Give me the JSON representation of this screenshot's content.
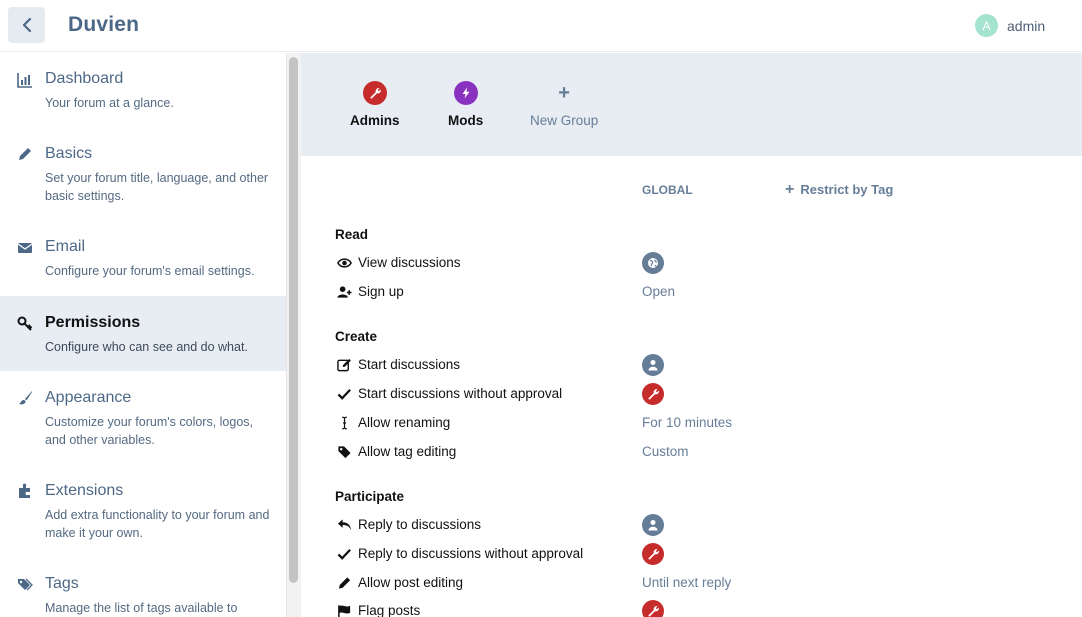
{
  "header": {
    "brand": "Duvien",
    "user": {
      "initial": "A",
      "name": "admin",
      "avatar_color": "#a4e3cf"
    },
    "back_icon": "chevron-left-icon"
  },
  "sidebar": {
    "items": [
      {
        "title": "Dashboard",
        "desc": "Your forum at a glance.",
        "icon": "bar-chart-icon",
        "active": false
      },
      {
        "title": "Basics",
        "desc": "Set your forum title, language, and other basic settings.",
        "icon": "pencil-icon",
        "active": false
      },
      {
        "title": "Email",
        "desc": "Configure your forum's email settings.",
        "icon": "envelope-icon",
        "active": false
      },
      {
        "title": "Permissions",
        "desc": "Configure who can see and do what.",
        "icon": "key-icon",
        "active": true
      },
      {
        "title": "Appearance",
        "desc": "Customize your forum's colors, logos, and other variables.",
        "icon": "paint-brush-icon",
        "active": false
      },
      {
        "title": "Extensions",
        "desc": "Add extra functionality to your forum and make it your own.",
        "icon": "puzzle-icon",
        "active": false
      },
      {
        "title": "Tags",
        "desc": "Manage the list of tags available to",
        "icon": "tags-icon",
        "active": false
      }
    ]
  },
  "groups": [
    {
      "label": "Admins",
      "icon": "wrench-icon",
      "color": "#c62c2c"
    },
    {
      "label": "Mods",
      "icon": "bolt-icon",
      "color": "#8a32c0"
    },
    {
      "label": "New Group",
      "icon": "plus-icon"
    }
  ],
  "columns": {
    "global": "GLOBAL",
    "restrict": "Restrict by Tag"
  },
  "sections": {
    "read": "Read",
    "create": "Create",
    "participate": "Participate"
  },
  "permissions": {
    "view_discussions": {
      "label": "View discussions",
      "icon": "eye-icon",
      "value_icon": "globe-icon"
    },
    "sign_up": {
      "label": "Sign up",
      "icon": "user-plus-icon",
      "value": "Open"
    },
    "start_discussions": {
      "label": "Start discussions",
      "icon": "edit-icon",
      "value_icon": "user-icon"
    },
    "start_without_approval": {
      "label": "Start discussions without approval",
      "icon": "check-icon",
      "value_icon": "wrench-icon"
    },
    "allow_renaming": {
      "label": "Allow renaming",
      "icon": "i-cursor-icon",
      "value": "For 10 minutes"
    },
    "allow_tag_editing": {
      "label": "Allow tag editing",
      "icon": "tag-icon",
      "value": "Custom"
    },
    "reply": {
      "label": "Reply to discussions",
      "icon": "reply-icon",
      "value_icon": "user-icon"
    },
    "reply_without_approval": {
      "label": "Reply to discussions without approval",
      "icon": "check-icon",
      "value_icon": "wrench-icon"
    },
    "allow_post_editing": {
      "label": "Allow post editing",
      "icon": "pencil-icon",
      "value": "Until next reply"
    },
    "flag_posts": {
      "label": "Flag posts",
      "icon": "flag-icon",
      "value_icon": "wrench-icon"
    }
  },
  "colors": {
    "accent": "#4d6886",
    "muted": "#667d98",
    "admin_red": "#c62c2c",
    "panel": "#e8edf3"
  }
}
